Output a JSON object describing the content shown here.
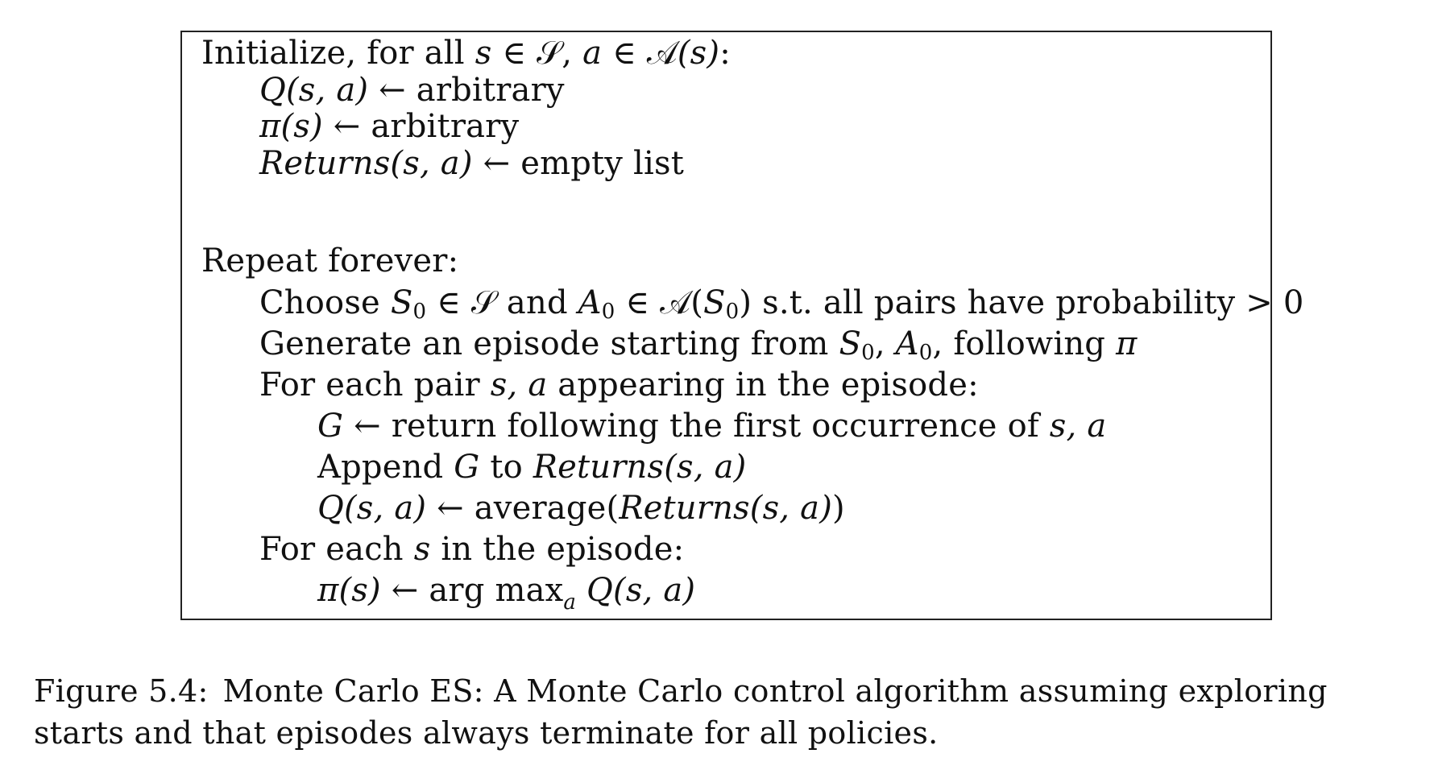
{
  "algorithm": {
    "init": {
      "pre": "Initialize, for all ",
      "s": "s",
      "in": " ∈ ",
      "S": "𝒮",
      "comma": ", ",
      "a": "a",
      "in2": " ∈ ",
      "A": "𝒜",
      "args": "(s)",
      "colon": ":"
    },
    "q_line": {
      "lhs": "Q(s, a)",
      "arrow": " ← ",
      "rhs": "arbitrary"
    },
    "pi_line": {
      "lhs": "π(s)",
      "arrow": " ← ",
      "rhs": "arbitrary"
    },
    "returns_line": {
      "lhs": "Returns(s, a)",
      "arrow": " ← ",
      "rhs": "empty list"
    },
    "repeat": "Repeat forever:",
    "choose": {
      "pre": "Choose ",
      "S0": "S",
      "sub0": "0",
      "in": " ∈ 𝒮 and ",
      "A0": "A",
      "sub1": "0",
      "in2": " ∈ 𝒜(",
      "S0b": "S",
      "sub2": "0",
      "post": ") s.t. all pairs have probability > 0"
    },
    "generate": {
      "pre": "Generate an episode starting from ",
      "S0": "S",
      "sub0": "0",
      "comma": ", ",
      "A0": "A",
      "sub1": "0",
      "mid": ", following ",
      "pi": "π"
    },
    "for_pair": {
      "pre": "For each pair ",
      "sa": "s, a",
      "post": " appearing in the episode:"
    },
    "g_line": {
      "G": "G",
      "mid": " ← return following the first occurrence of ",
      "sa": "s, a"
    },
    "append_line": {
      "pre": "Append ",
      "G": "G",
      "mid": " to ",
      "ret": "Returns(s, a)"
    },
    "avg_line": {
      "lhs": "Q(s, a)",
      "mid": " ← average(",
      "ret": "Returns(s, a)",
      "post": ")"
    },
    "for_s": {
      "pre": "For each ",
      "s": "s",
      "post": " in the episode:"
    },
    "argmax_line": {
      "lhs": "π(s)",
      "mid": " ← arg max",
      "sub": "a",
      "rhs": " Q(s, a)"
    }
  },
  "caption": {
    "label": "Figure 5.4:",
    "text": "Monte Carlo ES: A Monte Carlo control algorithm assuming exploring starts and that episodes always terminate for all policies."
  }
}
